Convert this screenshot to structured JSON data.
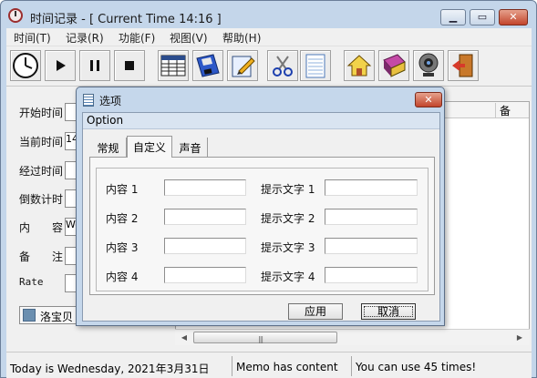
{
  "window": {
    "title": "时间记录 - [ Current Time 14:16 ]",
    "accent": "#c4d6ea"
  },
  "menu": [
    "时间(T)",
    "记录(R)",
    "功能(F)",
    "视图(V)",
    "帮助(H)"
  ],
  "toolbar": {
    "icons": [
      "clock-icon",
      "play-icon",
      "pause-icon",
      "stop-icon",
      "table-icon",
      "floppy-save-icon",
      "edit-icon",
      "scissors-icon",
      "notepad-icon",
      "home-icon",
      "book-icon",
      "webcam-icon",
      "exit-icon"
    ]
  },
  "form": {
    "fields": [
      {
        "label": "开始时间",
        "value": ""
      },
      {
        "label": "当前时间",
        "value": "14"
      },
      {
        "label": "经过时间",
        "value": ""
      },
      {
        "label": "倒数计时",
        "value": ""
      },
      {
        "label": "内　　容",
        "value": "Wo"
      },
      {
        "label": "备　　注",
        "value": ""
      },
      {
        "label": "Rate",
        "value": ""
      }
    ],
    "user_label": "洛宝贝"
  },
  "grid": {
    "columns": [
      "备"
    ]
  },
  "status": {
    "cells": [
      "Today is Wednesday, 2021年3月31日",
      "Memo has content",
      "You can use 45 times!"
    ]
  },
  "dialog": {
    "title": "选项",
    "header": "Option",
    "tabs": [
      {
        "label": "常规",
        "active": false
      },
      {
        "label": "自定义",
        "active": true
      },
      {
        "label": "声音",
        "active": false
      }
    ],
    "rows": [
      {
        "content_label": "内容 1",
        "content_value": "",
        "hint_label": "提示文字 1",
        "hint_value": ""
      },
      {
        "content_label": "内容 2",
        "content_value": "",
        "hint_label": "提示文字 2",
        "hint_value": ""
      },
      {
        "content_label": "内容 3",
        "content_value": "",
        "hint_label": "提示文字 3",
        "hint_value": ""
      },
      {
        "content_label": "内容 4",
        "content_value": "",
        "hint_label": "提示文字 4",
        "hint_value": ""
      }
    ],
    "apply_label": "应用",
    "cancel_label": "取消"
  }
}
